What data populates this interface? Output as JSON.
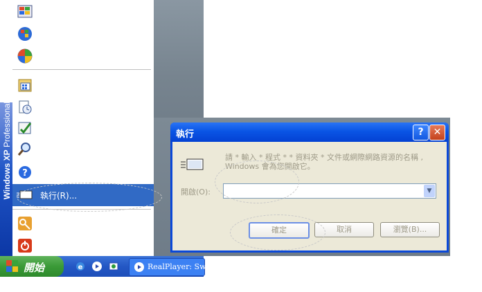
{
  "start_menu": {
    "brand": {
      "windows": "Windows XP",
      "edition": "Professional"
    },
    "items": [
      {
        "icon": "windows-catalog-icon"
      },
      {
        "icon": "windows-update-icon"
      },
      {
        "icon": "set-program-access-icon"
      },
      {
        "icon": "programs-folder-icon"
      },
      {
        "icon": "recent-documents-icon"
      },
      {
        "icon": "control-panel-icon"
      },
      {
        "icon": "search-icon"
      },
      {
        "icon": "help-icon"
      },
      {
        "icon": "log-off-icon"
      },
      {
        "icon": "shutdown-icon"
      }
    ],
    "run_label": "執行(R)..."
  },
  "taskbar": {
    "start_label": "開始",
    "quick_launch": [
      "internet-explorer-icon",
      "realplayer-icon",
      "outlook-express-icon"
    ],
    "task_label": "RealPlayer: Swi"
  },
  "run_dialog": {
    "title": "執行",
    "description": "請 * 輸入 * 程式 * * 資料夾 * 文件或網際網路資源的名稱 , Windows 會為您開啟它。",
    "open_label": "開啟(O):",
    "input_value": "",
    "buttons": {
      "ok": "確定",
      "cancel": "取消",
      "browse": "瀏覽(B)..."
    }
  }
}
